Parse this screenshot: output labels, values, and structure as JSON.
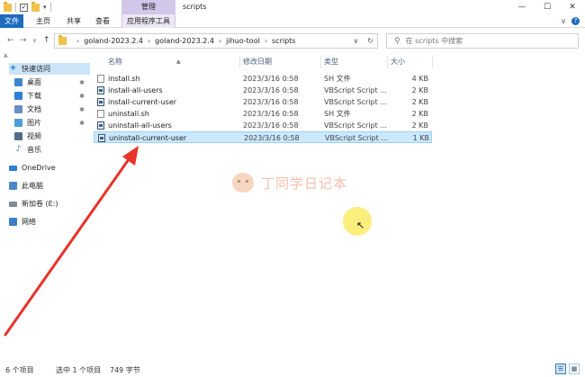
{
  "window": {
    "title": "scripts",
    "context_tab": "管理",
    "controls": {
      "minimize": "—",
      "maximize": "☐",
      "close": "✕"
    }
  },
  "ribbon": {
    "tabs": [
      "文件",
      "主页",
      "共享",
      "查看",
      "应用程序工具"
    ],
    "expand": "∨",
    "help": "?"
  },
  "nav": {
    "back": "←",
    "forward": "→",
    "history": "∨",
    "up": "↑",
    "breadcrumb": [
      "goland-2023.2.4",
      "goland-2023.2.4",
      "jihuo-tool",
      "scripts"
    ],
    "dropdown": "∨",
    "refresh": "↻"
  },
  "search": {
    "placeholder": "在 scripts 中搜索"
  },
  "sidebar": {
    "items": [
      {
        "label": "快速访问",
        "icon": "star-icon"
      },
      {
        "label": "桌面",
        "icon": "desktop-icon",
        "pinned": true
      },
      {
        "label": "下载",
        "icon": "download-icon",
        "pinned": true
      },
      {
        "label": "文档",
        "icon": "document-icon",
        "pinned": true
      },
      {
        "label": "图片",
        "icon": "picture-icon",
        "pinned": true
      },
      {
        "label": "视频",
        "icon": "video-icon"
      },
      {
        "label": "音乐",
        "icon": "music-icon"
      },
      {
        "label": "OneDrive",
        "icon": "cloud-icon"
      },
      {
        "label": "此电脑",
        "icon": "computer-icon"
      },
      {
        "label": "新加卷 (E:)",
        "icon": "drive-icon"
      },
      {
        "label": "网络",
        "icon": "network-icon"
      }
    ]
  },
  "files": {
    "columns": [
      "名称",
      "修改日期",
      "类型",
      "大小"
    ],
    "rows": [
      {
        "name": "install.sh",
        "date": "2023/3/16 0:58",
        "type": "SH 文件",
        "size": "4 KB",
        "icon": "sh-file-icon"
      },
      {
        "name": "install-all-users",
        "date": "2023/3/16 0:58",
        "type": "VBScript Script ...",
        "size": "2 KB",
        "icon": "vbscript-file-icon"
      },
      {
        "name": "install-current-user",
        "date": "2023/3/16 0:58",
        "type": "VBScript Script ...",
        "size": "2 KB",
        "icon": "vbscript-file-icon"
      },
      {
        "name": "uninstall.sh",
        "date": "2023/3/16 0:58",
        "type": "SH 文件",
        "size": "2 KB",
        "icon": "sh-file-icon"
      },
      {
        "name": "uninstall-all-users",
        "date": "2023/3/16 0:58",
        "type": "VBScript Script ...",
        "size": "2 KB",
        "icon": "vbscript-file-icon"
      },
      {
        "name": "uninstall-current-user",
        "date": "2023/3/16 0:58",
        "type": "VBScript Script ...",
        "size": "1 KB",
        "icon": "vbscript-file-icon",
        "selected": true
      }
    ]
  },
  "watermark": {
    "text": "丁同学日记本"
  },
  "status": {
    "item_count": "6 个项目",
    "selected": "选中 1 个项目",
    "size": "749 字节"
  },
  "colors": {
    "file_tab": "#1c6bbf",
    "selection": "#cce8ff",
    "annotation_arrow": "#e8322a",
    "cursor_highlight": "#f8e850"
  }
}
